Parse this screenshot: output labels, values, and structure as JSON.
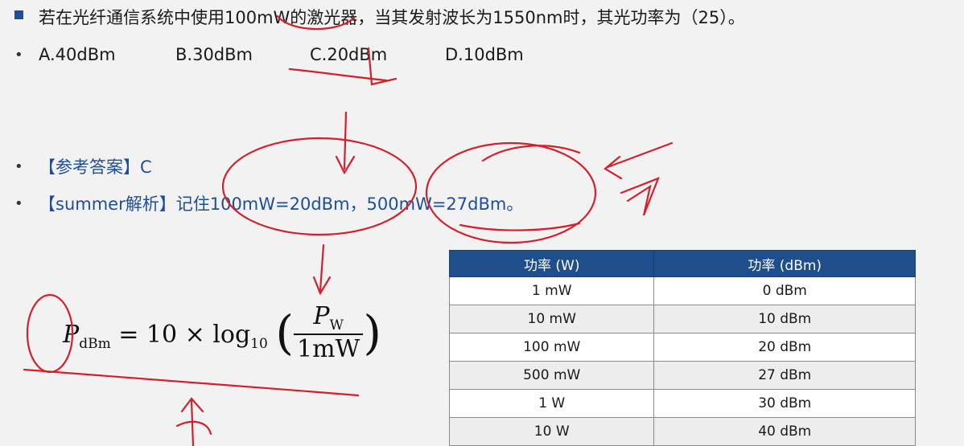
{
  "question": {
    "text": "若在光纤通信系统中使用100mW的激光器，当其发射波长为1550nm时，其光功率为（25）。",
    "options": [
      "A.40dBm",
      "B.30dBm",
      "C.20dBm",
      "D.10dBm"
    ]
  },
  "answer": {
    "label": "【参考答案】C"
  },
  "analysis": {
    "label": "【summer解析】",
    "text": "记住100mW=20dBm，500mW=27dBm。"
  },
  "formula": {
    "lhs": "P",
    "lhs_sub": "dBm",
    "mid": "= 10 × log",
    "mid_sub": "10",
    "num": "P",
    "num_sub": "W",
    "den": "1mW"
  },
  "table": {
    "headers": [
      "功率 (W)",
      "功率 (dBm)"
    ],
    "rows": [
      [
        "1 mW",
        "0 dBm"
      ],
      [
        "10 mW",
        "10 dBm"
      ],
      [
        "100 mW",
        "20 dBm"
      ],
      [
        "500 mW",
        "27 dBm"
      ],
      [
        "1 W",
        "30 dBm"
      ],
      [
        "10 W",
        "40 dBm"
      ]
    ]
  },
  "colors": {
    "bullet_blue": "#1f4e99",
    "header_blue": "#1f4e8c",
    "ink_red": "#d4202a"
  }
}
